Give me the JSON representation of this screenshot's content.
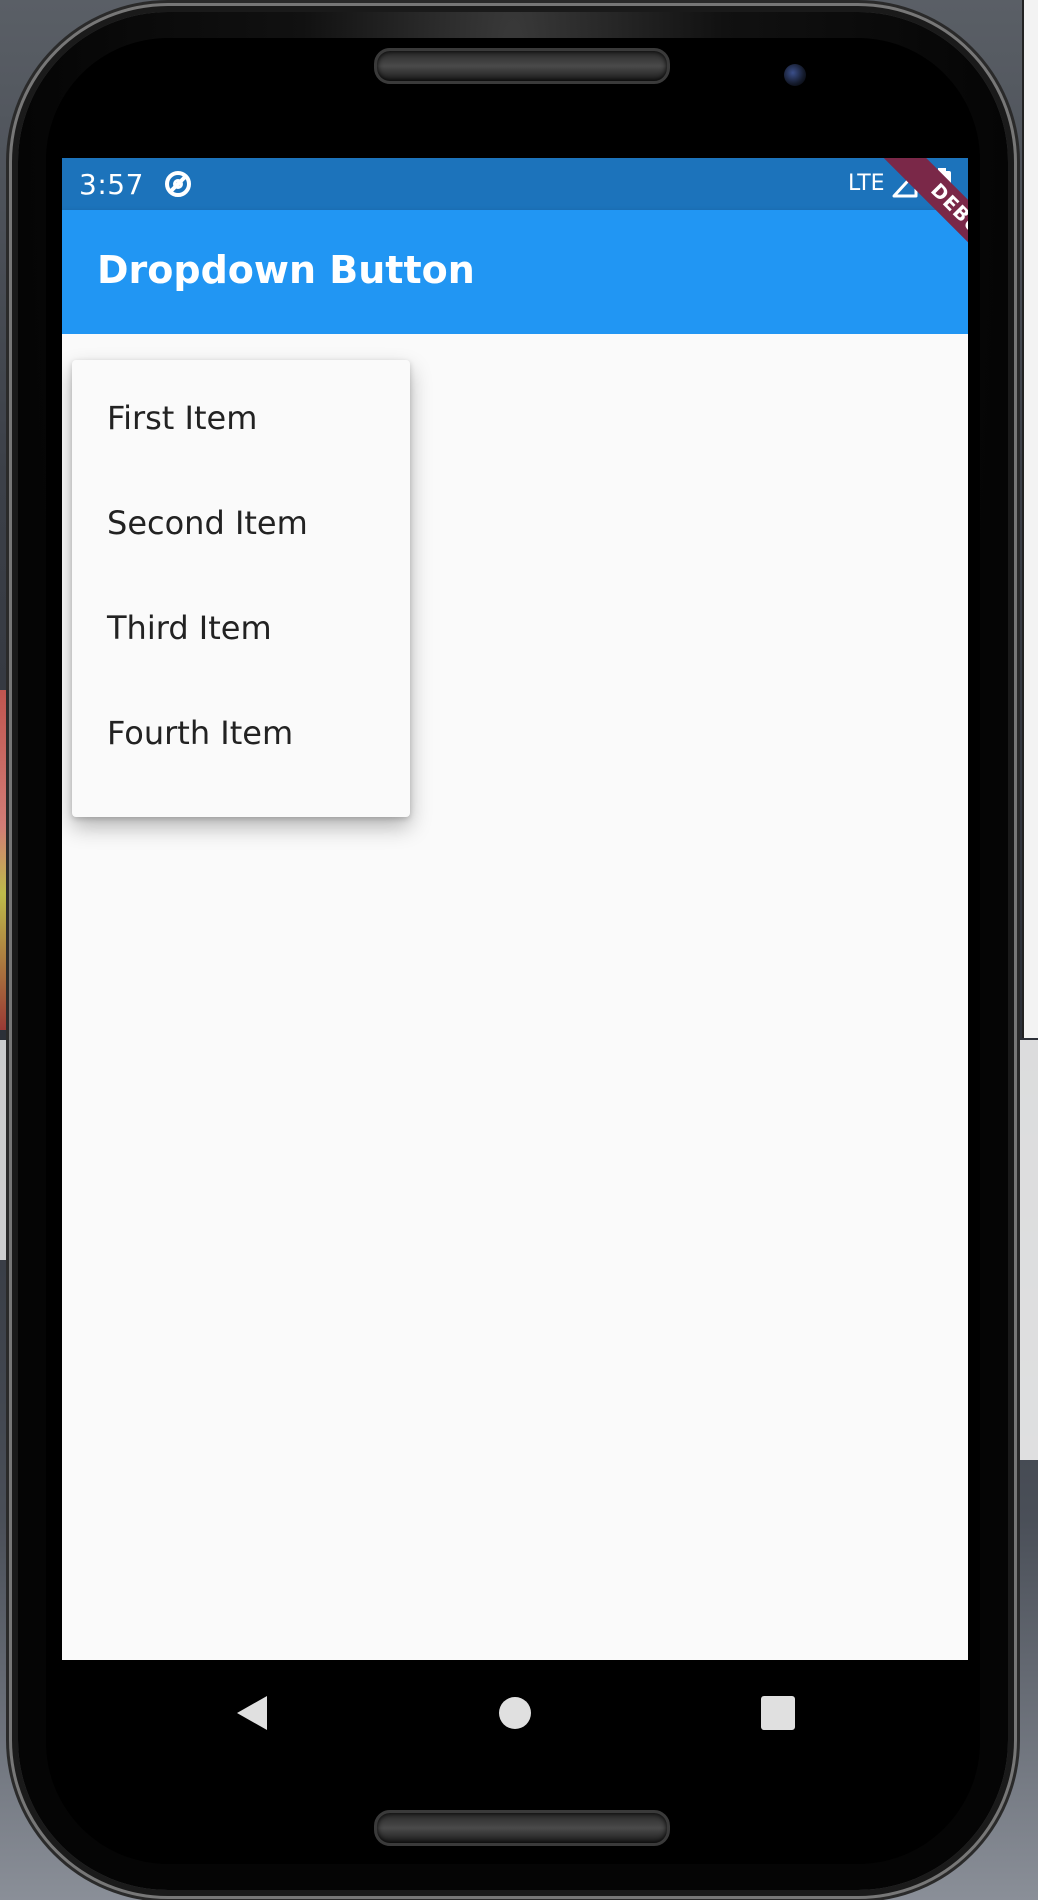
{
  "status_bar": {
    "time": "3:57",
    "network": "LTE",
    "icons": [
      "app-notification-icon",
      "signal-icon",
      "battery-icon"
    ]
  },
  "app_bar": {
    "title": "Dropdown Button",
    "debug_banner": "DEBUG",
    "color": "#2196f3",
    "status_color": "#1c73bb"
  },
  "dropdown": {
    "items": [
      {
        "label": "First Item"
      },
      {
        "label": "Second Item"
      },
      {
        "label": "Third Item"
      },
      {
        "label": "Fourth Item"
      }
    ]
  },
  "nav_bar": {
    "buttons": [
      "back-icon",
      "home-icon",
      "recents-icon"
    ]
  }
}
